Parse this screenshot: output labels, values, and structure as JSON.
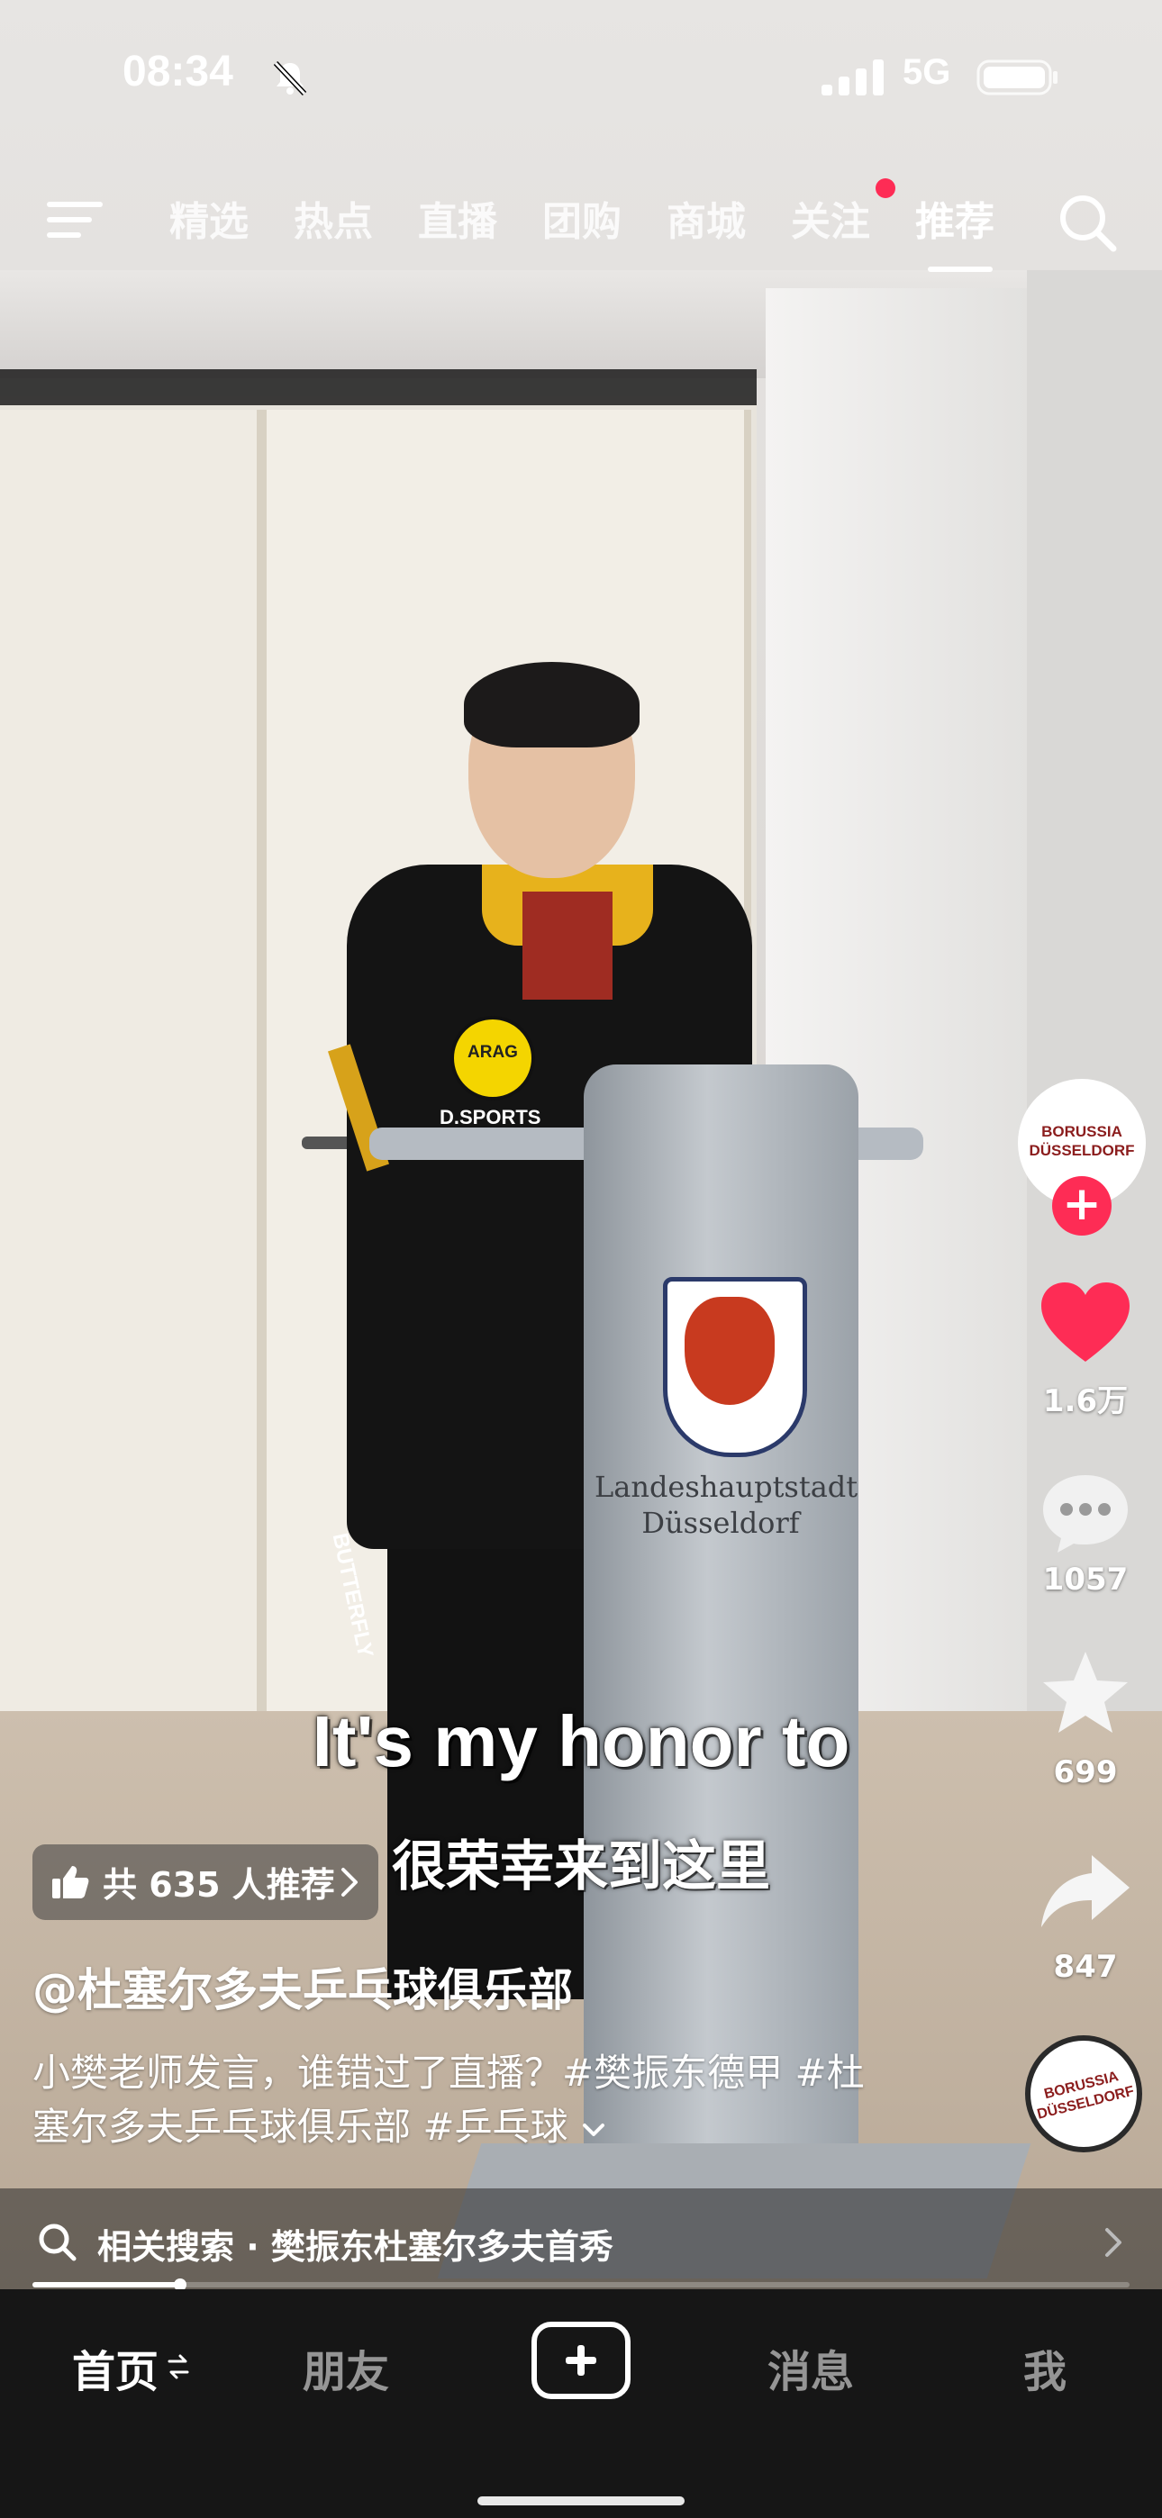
{
  "status_bar": {
    "time": "08:34",
    "network": "5G"
  },
  "top_tabs": {
    "items": [
      "精选",
      "热点",
      "直播",
      "团购",
      "商城",
      "关注",
      "推荐"
    ],
    "active": "推荐"
  },
  "video_scene": {
    "lectern_line1": "Landeshauptstadt",
    "lectern_line2": "Düsseldorf",
    "logo_arag": "ARAG",
    "jersey_sponsor": "D.SPORTS",
    "leg_text": "BUTTERFLY"
  },
  "creator": {
    "avatar_text_line1": "BORUSSIA",
    "avatar_text_line2": "DÜSSELDORF"
  },
  "actions": {
    "likes": "1.6万",
    "comments": "1057",
    "favorites": "699",
    "shares": "847"
  },
  "captions": {
    "english": "It's my honor to",
    "chinese": "很荣幸来到这里"
  },
  "recommend_chip": {
    "text": "共 635 人推荐"
  },
  "post": {
    "author": "@杜塞尔多夫乒乓球俱乐部",
    "description_line1": "小樊老师发言，谁错过了直播？#樊振东德甲 #杜",
    "description_line2": "塞尔多夫乒乓球俱乐部 #乒乓球"
  },
  "related_search": {
    "label": "相关搜索",
    "separator": "·",
    "query": "樊振东杜塞尔多夫首秀"
  },
  "playback": {
    "progress_fraction": 0.135
  },
  "bottom_nav": {
    "home": "首页",
    "friends": "朋友",
    "messages": "消息",
    "me": "我"
  },
  "colors": {
    "accent_red": "#fe2c55",
    "nav_bg": "#161616"
  },
  "icons": [
    "menu-icon",
    "search-icon",
    "mute-icon",
    "signal-icon",
    "battery-icon",
    "heart-icon",
    "comment-icon",
    "star-icon",
    "share-icon",
    "thumb-up-icon",
    "chevron-right-icon",
    "chevron-down-icon",
    "plus-icon",
    "refresh-icon"
  ]
}
